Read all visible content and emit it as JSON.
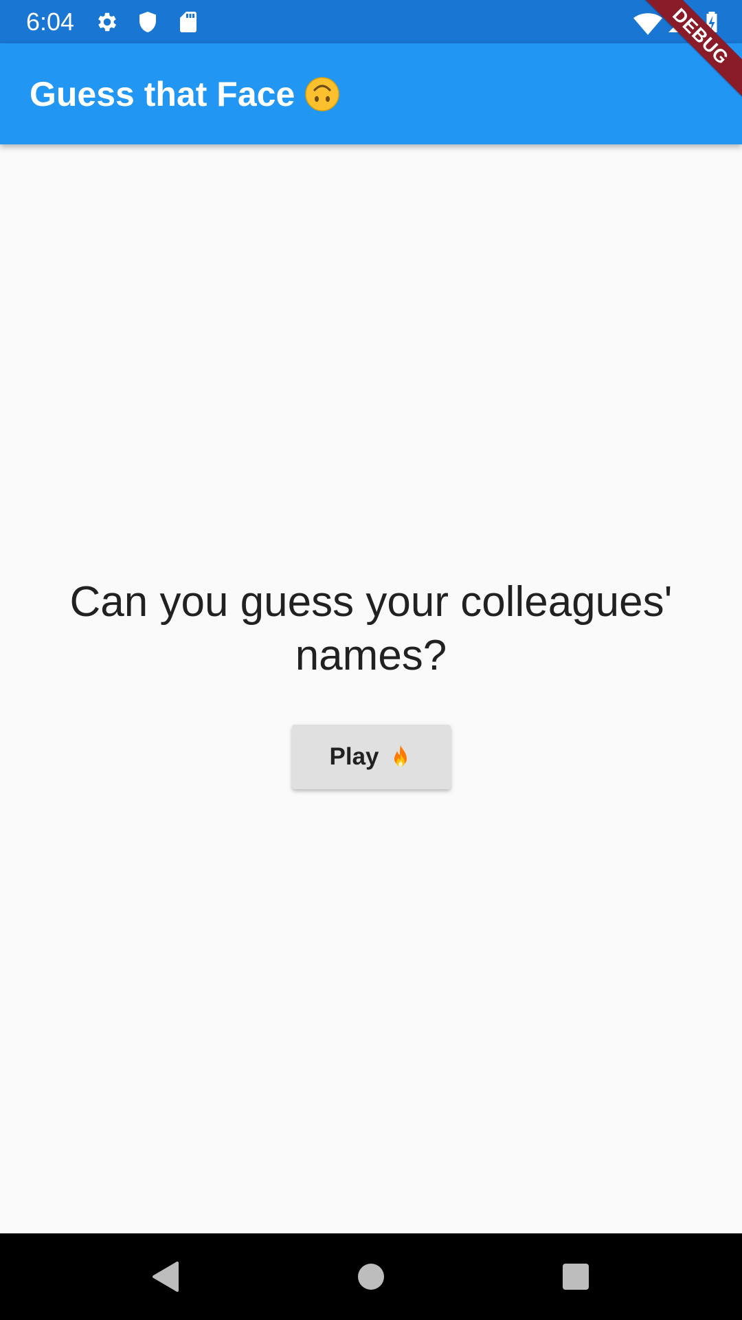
{
  "status_bar": {
    "time": "6:04",
    "icons": [
      "gear-icon",
      "shield-icon",
      "sd-card-icon",
      "wifi-icon",
      "signal-icon",
      "battery-charging-icon"
    ]
  },
  "app_bar": {
    "title": "Guess that Face",
    "title_emoji": "upside-down-face-icon",
    "color": "#2196f3"
  },
  "debug_banner": {
    "label": "DEBUG",
    "color": "#8a1c2a"
  },
  "main": {
    "prompt": "Can you guess your colleagues' names?",
    "play_button": {
      "label": "Play",
      "emoji": "fire-icon"
    }
  },
  "nav_bar": {
    "buttons": [
      "back-icon",
      "home-icon",
      "recents-icon"
    ]
  }
}
